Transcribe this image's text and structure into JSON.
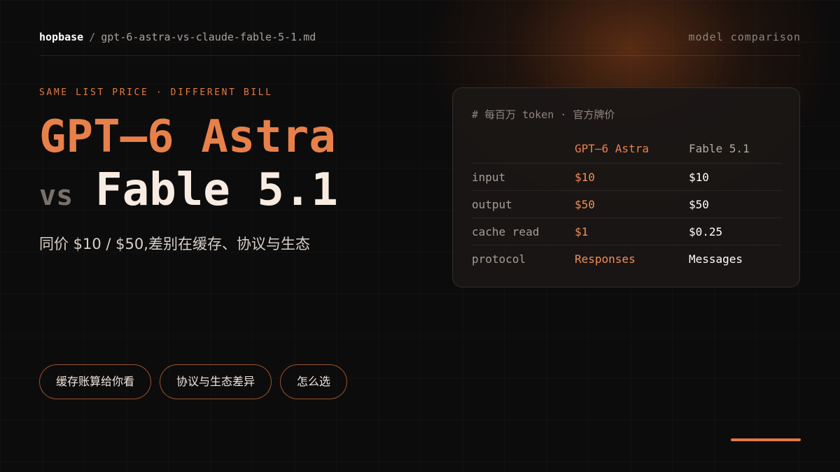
{
  "header": {
    "brand": "hopbase",
    "separator": "/",
    "filename": "gpt-6-astra-vs-claude-fable-5-1.md",
    "section": "model comparison"
  },
  "hero": {
    "eyebrow": "SAME LIST PRICE · DIFFERENT BILL",
    "title_model_a": "GPT–6 Astra",
    "vs_label": "vs",
    "title_model_b": "Fable 5.1",
    "subtitle": "同价 $10 / $50,差别在缓存、协议与生态"
  },
  "price_card": {
    "note": "# 每百万 token · 官方牌价",
    "columns": [
      "",
      "GPT–6 Astra",
      "Fable 5.1"
    ],
    "rows": [
      {
        "label": "input",
        "a": "$10",
        "b": "$10"
      },
      {
        "label": "output",
        "a": "$50",
        "b": "$50"
      },
      {
        "label": "cache read",
        "a": "$1",
        "b": "$0.25"
      },
      {
        "label": "protocol",
        "a": "Responses",
        "b": "Messages"
      }
    ]
  },
  "nav_pills": [
    {
      "label": "缓存账算给你看"
    },
    {
      "label": "协议与生态差异"
    },
    {
      "label": "怎么选"
    }
  ],
  "colors": {
    "accent": "#e07a43",
    "background": "#0d0c0c",
    "text_light": "#f8ece2"
  }
}
